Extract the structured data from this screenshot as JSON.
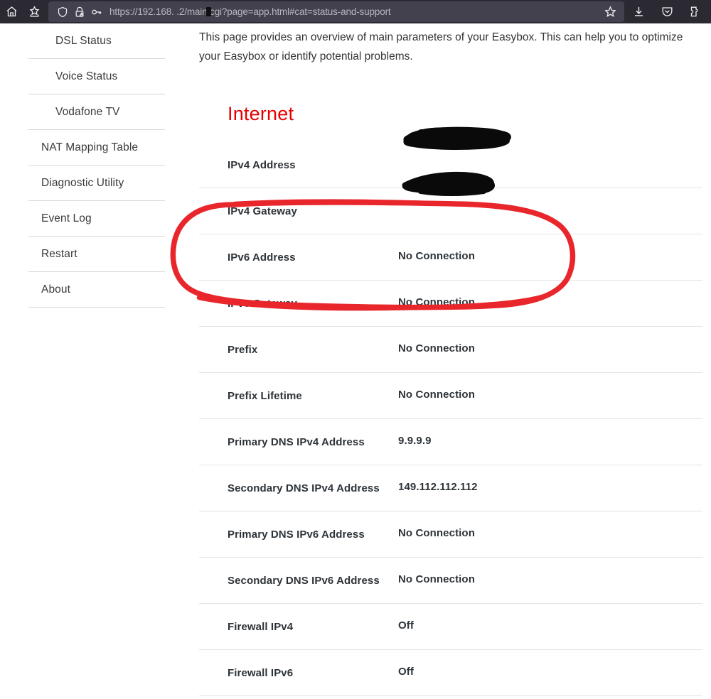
{
  "browser": {
    "url": "https://192.168.  .2/main.cgi?page=app.html#cat=status-and-support",
    "left_buttons": [
      {
        "name": "home-icon",
        "label": "Home"
      },
      {
        "name": "bookmarks-icon",
        "label": "Bookmarks"
      }
    ],
    "urlbar_icons": [
      {
        "name": "shield-icon",
        "label": "Tracking protection"
      },
      {
        "name": "lock-warning-icon",
        "label": "Connection not secure"
      },
      {
        "name": "key-icon",
        "label": "Saved logins"
      }
    ],
    "right_buttons": [
      {
        "name": "bookmark-star-icon",
        "label": "Bookmark this page"
      },
      {
        "name": "download-icon",
        "label": "Downloads"
      },
      {
        "name": "pocket-icon",
        "label": "Save to Pocket"
      },
      {
        "name": "extension-icon",
        "label": "Extensions"
      }
    ]
  },
  "sidebar": {
    "items": [
      {
        "label": "DSL Status",
        "level": "sub"
      },
      {
        "label": "Voice Status",
        "level": "sub"
      },
      {
        "label": "Vodafone TV",
        "level": "sub"
      },
      {
        "label": "NAT Mapping Table",
        "level": "top"
      },
      {
        "label": "Diagnostic Utility",
        "level": "top"
      },
      {
        "label": "Event Log",
        "level": "top"
      },
      {
        "label": "Restart",
        "level": "top"
      },
      {
        "label": "About",
        "level": "top"
      }
    ]
  },
  "content": {
    "intro": "This page provides an overview of main parameters of your Easybox. This can help you to optimize your Easybox or identify potential problems.",
    "section_title": "Internet",
    "section_title_color": "#e60000",
    "rows": [
      {
        "label": "IPv4 Address",
        "value": "",
        "redacted": true,
        "highlighted": false
      },
      {
        "label": "IPv4 Gateway",
        "value": "",
        "redacted": true,
        "highlighted": false
      },
      {
        "label": "IPv6 Address",
        "value": "No Connection",
        "redacted": false,
        "highlighted": true
      },
      {
        "label": "IPv6 Gateway",
        "value": "No Connection",
        "redacted": false,
        "highlighted": true
      },
      {
        "label": "Prefix",
        "value": "No Connection",
        "redacted": false,
        "highlighted": false
      },
      {
        "label": "Prefix Lifetime",
        "value": "No Connection",
        "redacted": false,
        "highlighted": false
      },
      {
        "label": "Primary DNS IPv4 Address",
        "value": "9.9.9.9",
        "redacted": false,
        "highlighted": false
      },
      {
        "label": "Secondary DNS IPv4 Address",
        "value": "149.112.112.112",
        "redacted": false,
        "highlighted": false
      },
      {
        "label": "Primary DNS IPv6 Address",
        "value": "No Connection",
        "redacted": false,
        "highlighted": false
      },
      {
        "label": "Secondary DNS IPv6 Address",
        "value": "No Connection",
        "redacted": false,
        "highlighted": false
      },
      {
        "label": "Firewall IPv4",
        "value": "Off",
        "redacted": false,
        "highlighted": false
      },
      {
        "label": "Firewall IPv6",
        "value": "Off",
        "redacted": false,
        "highlighted": false
      }
    ]
  },
  "annotations": {
    "circle_color": "#e8262b",
    "redaction_color": "#0a0a0a",
    "circle_target": "IPv6 Address and IPv6 Gateway rows"
  }
}
